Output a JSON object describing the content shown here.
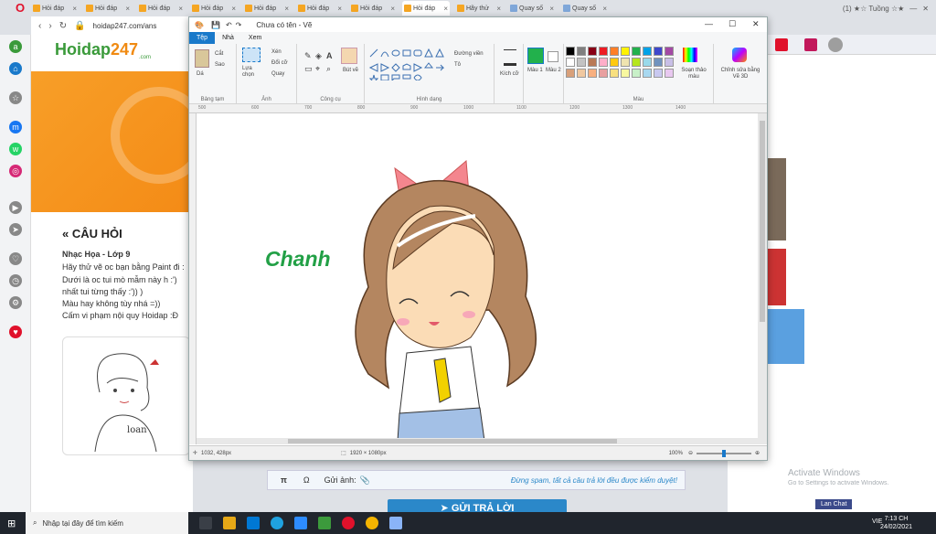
{
  "browser": {
    "tabs": [
      {
        "label": "Hỏi đáp"
      },
      {
        "label": "Hỏi đáp"
      },
      {
        "label": "Hỏi đáp"
      },
      {
        "label": "Hỏi đáp"
      },
      {
        "label": "Hỏi đáp"
      },
      {
        "label": "Hỏi đáp"
      },
      {
        "label": "Hỏi đáp"
      },
      {
        "label": "Hỏi đáp"
      },
      {
        "label": "Hãy thử"
      },
      {
        "label": "Quay số"
      },
      {
        "label": "Quay số"
      }
    ],
    "url": "hoidap247.com/ans",
    "right_tab_label": "(1) ★☆ Tuồng ☆★"
  },
  "webpage": {
    "logo_main": "Hoidap",
    "logo_num": "247",
    "logo_sub": ".com",
    "section_title": "« CÂU HỎI",
    "subject": "Nhạc Họa - Lớp 9",
    "question_lines": [
      "Hãy thử vẽ oc bạn bằng Paint đi :",
      "Dưới là oc tui mò mẫm này h :')",
      "nhất tui từng thấy :')) )",
      "Màu hay không tùy nhá =))",
      "Cấm vi phạm nội quy Hoidap :Đ"
    ],
    "sketch_text": "loan",
    "comment_bar": {
      "pi": "π",
      "omega": "Ω",
      "send_image": "Gửi ảnh:",
      "notice": "Đừng spam, tất cả câu trả lời đều được kiểm duyệt!"
    },
    "reply_button": "GỬI TRẢ LỜI"
  },
  "paint": {
    "window_title": "Chưa có tên - Vẽ",
    "menu": [
      "Tệp",
      "Nhà",
      "Xem"
    ],
    "ribbon": {
      "clipboard_label": "Bảng tạm",
      "paste": "Dá",
      "cut": "Cắt",
      "copy": "Sao",
      "image_label": "Ảnh",
      "select": "Lựa chọn",
      "crop": "Xén",
      "resize": "Đổi cỡ",
      "rotate": "Quay",
      "tools_label": "Công cụ",
      "brushes": "Bút vẽ",
      "shapes_label": "Hình dạng",
      "outline": "Đường viền",
      "fill": "Tô",
      "size": "Kích cỡ",
      "color1": "Màu 1",
      "color2": "Màu 2",
      "colors_label": "Màu",
      "edit_colors": "Soạn thảo màu",
      "paint3d": "Chỉnh sửa bằng Vẽ 3D"
    },
    "palette": [
      "#000000",
      "#7f7f7f",
      "#880015",
      "#ed1c24",
      "#ff7f27",
      "#fff200",
      "#22b14c",
      "#00a2e8",
      "#3f48cc",
      "#a349a4",
      "#ffffff",
      "#c3c3c3",
      "#b97a57",
      "#ffaec9",
      "#ffc90e",
      "#efe4b0",
      "#b5e61d",
      "#99d9ea",
      "#7092be",
      "#c8bfe7",
      "#d8a07a",
      "#f0c8a0",
      "#f8b080",
      "#e8a0a0",
      "#f8e080",
      "#f8f8a0",
      "#c8f0c8",
      "#a8d8f0",
      "#c8c8f0",
      "#e8c8f0"
    ],
    "color1_value": "#22b14c",
    "ruler_marks": [
      "500",
      "600",
      "700",
      "800",
      "900",
      "1000",
      "1100",
      "1200",
      "1300",
      "1400"
    ],
    "canvas_text": "Chanh",
    "status": {
      "cursor": "1032, 428px",
      "size": "1920 × 1080px",
      "zoom": "100%"
    }
  },
  "taskbar": {
    "search_placeholder": "Nhập tại đây để tìm kiếm",
    "time": "7:13 CH",
    "date": "24/02/2021",
    "lang": "VIE"
  },
  "overlay": {
    "activate_title": "Activate Windows",
    "activate_sub": "Go to Settings to activate Windows.",
    "lan_chat": "Lan Chat"
  }
}
